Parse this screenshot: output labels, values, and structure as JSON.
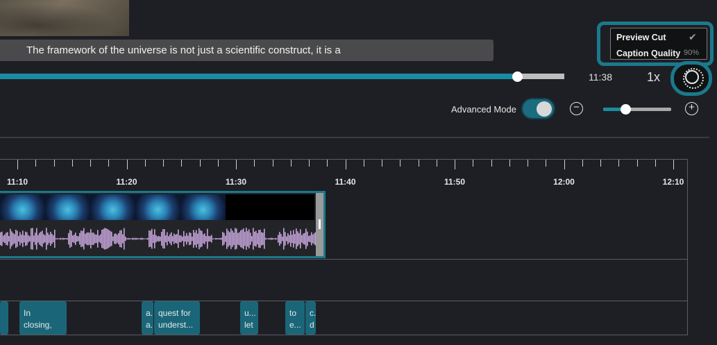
{
  "caption": {
    "text": "The framework of the universe is not just a scientific construct, it is a"
  },
  "settings_menu": {
    "preview_cut_label": "Preview Cut",
    "preview_cut_check": "✔",
    "caption_quality_label": "Caption Quality",
    "caption_quality_value": "90%"
  },
  "playback": {
    "time": "11:38",
    "speed": "1x",
    "progress_percent": 91.6
  },
  "controls": {
    "advanced_mode_label": "Advanced Mode",
    "advanced_mode_on": true,
    "zoom_out_symbol": "−",
    "zoom_in_symbol": "+",
    "zoom_level_percent": 33
  },
  "timeline": {
    "tick_labels": [
      "11:10",
      "11:20",
      "11:30",
      "11:40",
      "11:50",
      "12:00",
      "12:10"
    ]
  },
  "words": [
    {
      "line1": "",
      "line2": ""
    },
    {
      "line1": "In",
      "line2": "closing,"
    },
    {
      "line1": "a..",
      "line2": "a..."
    },
    {
      "line1": "quest for",
      "line2": "underst..."
    },
    {
      "line1": "u...",
      "line2": "let"
    },
    {
      "line1": "to",
      "line2": "e..."
    },
    {
      "line1": "c..",
      "line2": "d"
    }
  ],
  "colors": {
    "accent": "#1a8ca2",
    "waveform": "#c7a7dd",
    "chip": "#1a6678"
  }
}
